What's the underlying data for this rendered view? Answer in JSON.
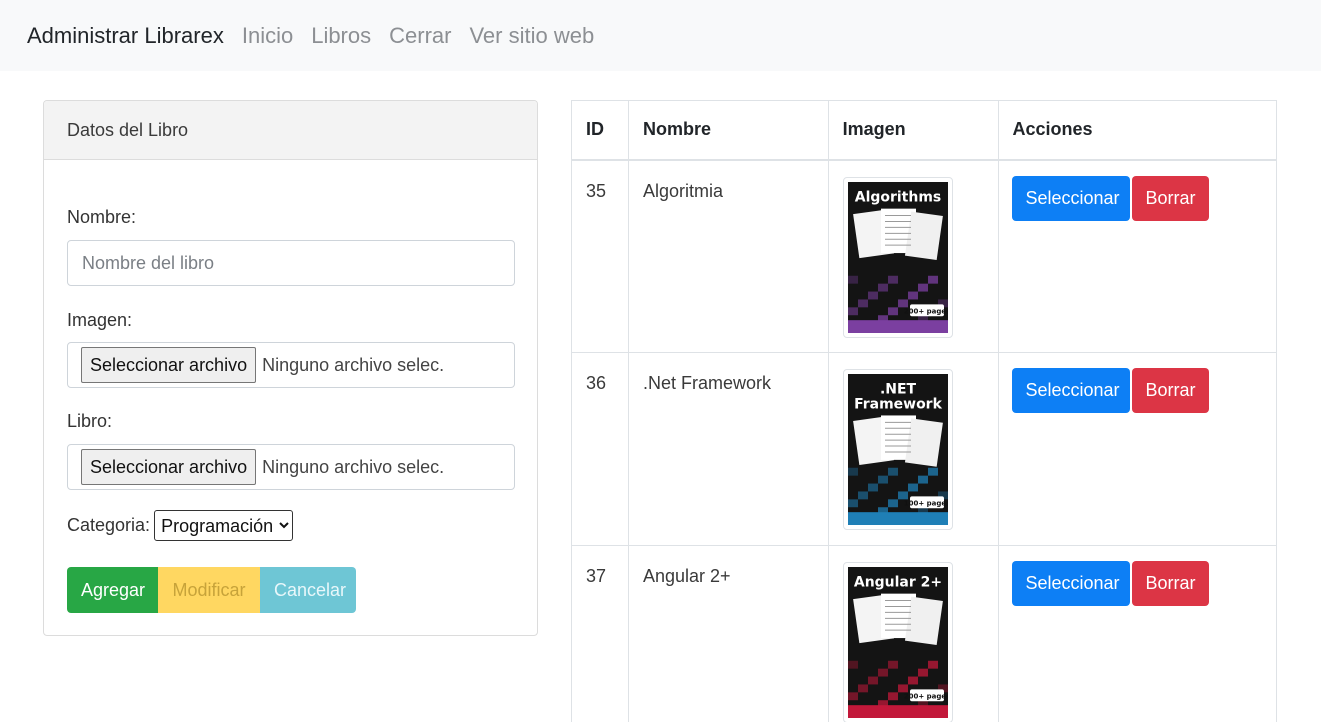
{
  "navbar": {
    "brand": "Administrar Librarex",
    "links": [
      "Inicio",
      "Libros",
      "Cerrar",
      "Ver sitio web"
    ]
  },
  "form": {
    "header": "Datos del Libro",
    "nombre_label": "Nombre:",
    "nombre_placeholder": "Nombre del libro",
    "imagen_label": "Imagen:",
    "libro_label": "Libro:",
    "file_button": "Seleccionar archivo",
    "file_status": "Ninguno archivo selec.",
    "categoria_label": "Categoria:",
    "categoria_value": "Programación",
    "buttons": {
      "add": "Agregar",
      "modify": "Modificar",
      "cancel": "Cancelar"
    }
  },
  "table": {
    "headers": [
      "ID",
      "Nombre",
      "Imagen",
      "Acciones"
    ],
    "select_label": "Seleccionar",
    "delete_label": "Borrar",
    "rows": [
      {
        "id": "35",
        "name": "Algoritmia",
        "cover_title": [
          "Algorithms"
        ],
        "cover_pages": "200+ pages",
        "cover_color": "#7b3fa0"
      },
      {
        "id": "36",
        "name": ".Net Framework",
        "cover_title": [
          ".NET",
          "Framework"
        ],
        "cover_pages": "100+ pages",
        "cover_color": "#1f7fb6"
      },
      {
        "id": "37",
        "name": "Angular 2+",
        "cover_title": [
          "Angular 2+"
        ],
        "cover_pages": "200+ pages",
        "cover_color": "#c2183a"
      }
    ]
  }
}
